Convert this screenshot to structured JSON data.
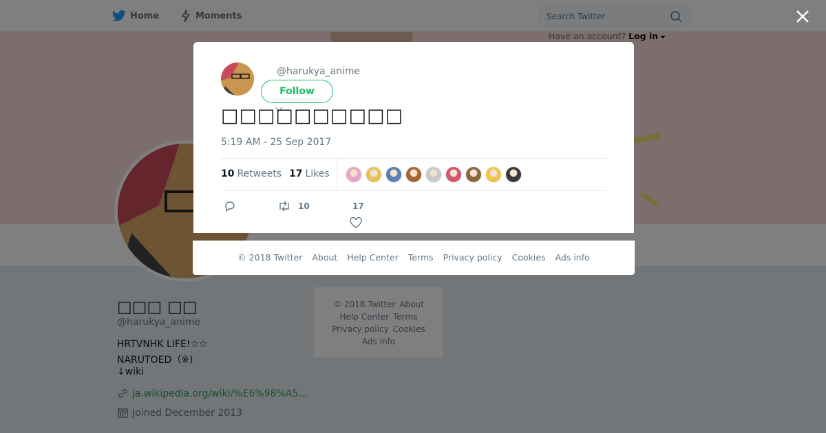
{
  "topnav": {
    "home_label": "Home",
    "moments_label": "Moments",
    "search_placeholder": "Search Twitter",
    "login_prompt": "Have an account?",
    "login_link": "Log in",
    "brand_color": "#1da1f2"
  },
  "profile": {
    "name": "□□□ □□",
    "handle": "@harukya_anime",
    "bio": [
      "HRTVNHK LIFE!☆☆",
      "NARUTOED（※)",
      "↓wiki"
    ],
    "link": "ja.wikipedia.org/wiki/%E6%98%A5…",
    "joined": "Joined December 2013"
  },
  "side_footer": {
    "items": [
      "© 2018 Twitter",
      "About",
      "Help Center",
      "Terms",
      "Privacy policy",
      "Cookies",
      "Ads info"
    ]
  },
  "modal": {
    "handle": "@harukya_anime",
    "follow_label": "Follow",
    "tweet_text": "□□□□□□□□□□",
    "timestamp": "5:19 AM - 25 Sep 2017",
    "retweets_count": "10",
    "retweets_label": "Retweets",
    "likes_count": "17",
    "likes_label": "Likes",
    "liker_colors": [
      "#e9a6c9",
      "#e7c35a",
      "#5a7fb0",
      "#a8652d",
      "#c9c9c9",
      "#d6576b",
      "#8a6a3d",
      "#f0c64a",
      "#3a3a3a"
    ],
    "action_retweet_count": "10",
    "action_like_count": "17",
    "accent_color": "#17bf63"
  },
  "modal_footer": {
    "items": [
      "© 2018 Twitter",
      "About",
      "Help Center",
      "Terms",
      "Privacy policy",
      "Cookies",
      "Ads info"
    ]
  }
}
